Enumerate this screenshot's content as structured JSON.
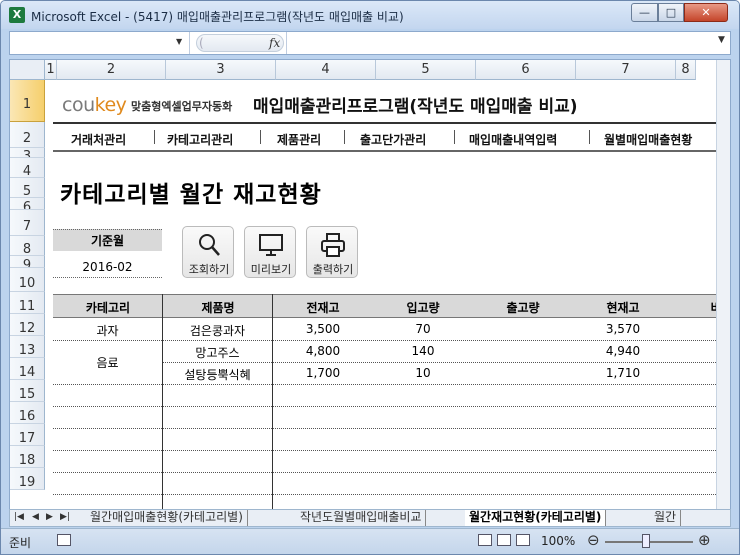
{
  "window": {
    "title": "Microsoft Excel - (5417) 매입매출관리프로그램(작년도 매입매출 비교)",
    "app_icon": "X"
  },
  "window_buttons": {
    "minimize": "—",
    "maximize": "□",
    "close": "✕"
  },
  "formula_bar": {
    "name_box": "",
    "fx_label": "fx",
    "formula": ""
  },
  "columns": [
    "1",
    "2",
    "3",
    "4",
    "5",
    "6",
    "7",
    "8"
  ],
  "rows": [
    "1",
    "2",
    "3",
    "4",
    "5",
    "6",
    "7",
    "8",
    "9",
    "10",
    "11",
    "12",
    "13",
    "14",
    "15",
    "16",
    "17",
    "18",
    "19"
  ],
  "banner": {
    "logo_main": "cou",
    "logo_key": "key",
    "logo_sub": "맞춤형엑셀업무자동화",
    "program_title": "매입매출관리프로그램(작년도 매입매출 비교)"
  },
  "menu": [
    "거래처관리",
    "카테고리관리",
    "제품관리",
    "출고단가관리",
    "매입매출내역입력",
    "월별매입매출현황"
  ],
  "page_title": "카테고리별 월간 재고현황",
  "filter": {
    "label": "기준월",
    "value": "2016-02"
  },
  "buttons": {
    "search": "조회하기",
    "preview": "미리보기",
    "print": "출력하기"
  },
  "table": {
    "headers": [
      "카테고리",
      "제품명",
      "전재고",
      "입고량",
      "출고량",
      "현재고",
      "비"
    ],
    "rows": [
      {
        "category": "과자",
        "product": "검은콩과자",
        "prev": "3,500",
        "in": "70",
        "out": "",
        "current": "3,570"
      },
      {
        "category": "음료",
        "product": "망고주스",
        "prev": "4,800",
        "in": "140",
        "out": "",
        "current": "4,940"
      },
      {
        "category": "",
        "product": "설탕등뿍식혜",
        "prev": "1,700",
        "in": "10",
        "out": "",
        "current": "1,710"
      }
    ]
  },
  "sheet_tabs": [
    "월간매입매출현황(카테고리별)",
    "작년도월별매입매출비교",
    "월간재고현황(카테고리별)",
    "월간"
  ],
  "active_tab": "월간재고현황(카테고리별)",
  "status": {
    "mode": "준비",
    "zoom": "100%"
  },
  "colors": {
    "title_bg": "#c3d6ef",
    "header_fill": "#d9d9d9",
    "logo_accent": "#e08a1e",
    "row1_selected": "#f5cf6c"
  }
}
